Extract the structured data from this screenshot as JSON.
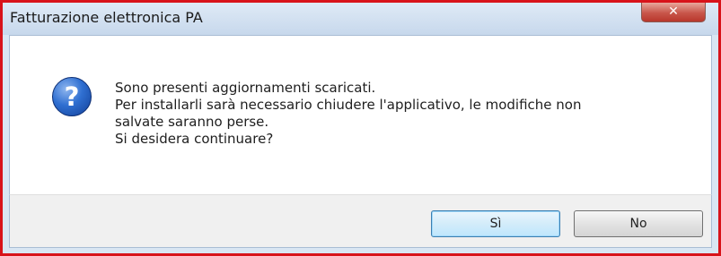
{
  "window": {
    "title": "Fatturazione elettronica PA",
    "close_glyph": "✕"
  },
  "icon": {
    "name": "question-icon",
    "glyph": "?"
  },
  "message": {
    "lines": [
      "Sono presenti aggiornamenti scaricati.",
      "Per installarli sarà necessario chiudere l'applicativo, le modifiche non",
      "salvate saranno perse.",
      "Si desidera continuare?"
    ]
  },
  "buttons": {
    "yes_label": "Sì",
    "no_label": "No"
  },
  "colors": {
    "accent_border": "#d8131a",
    "frame": "#d9e6f3",
    "close_button": "#c8564a",
    "icon": "#2f6fd1",
    "default_button_border": "#3c7fb1"
  }
}
